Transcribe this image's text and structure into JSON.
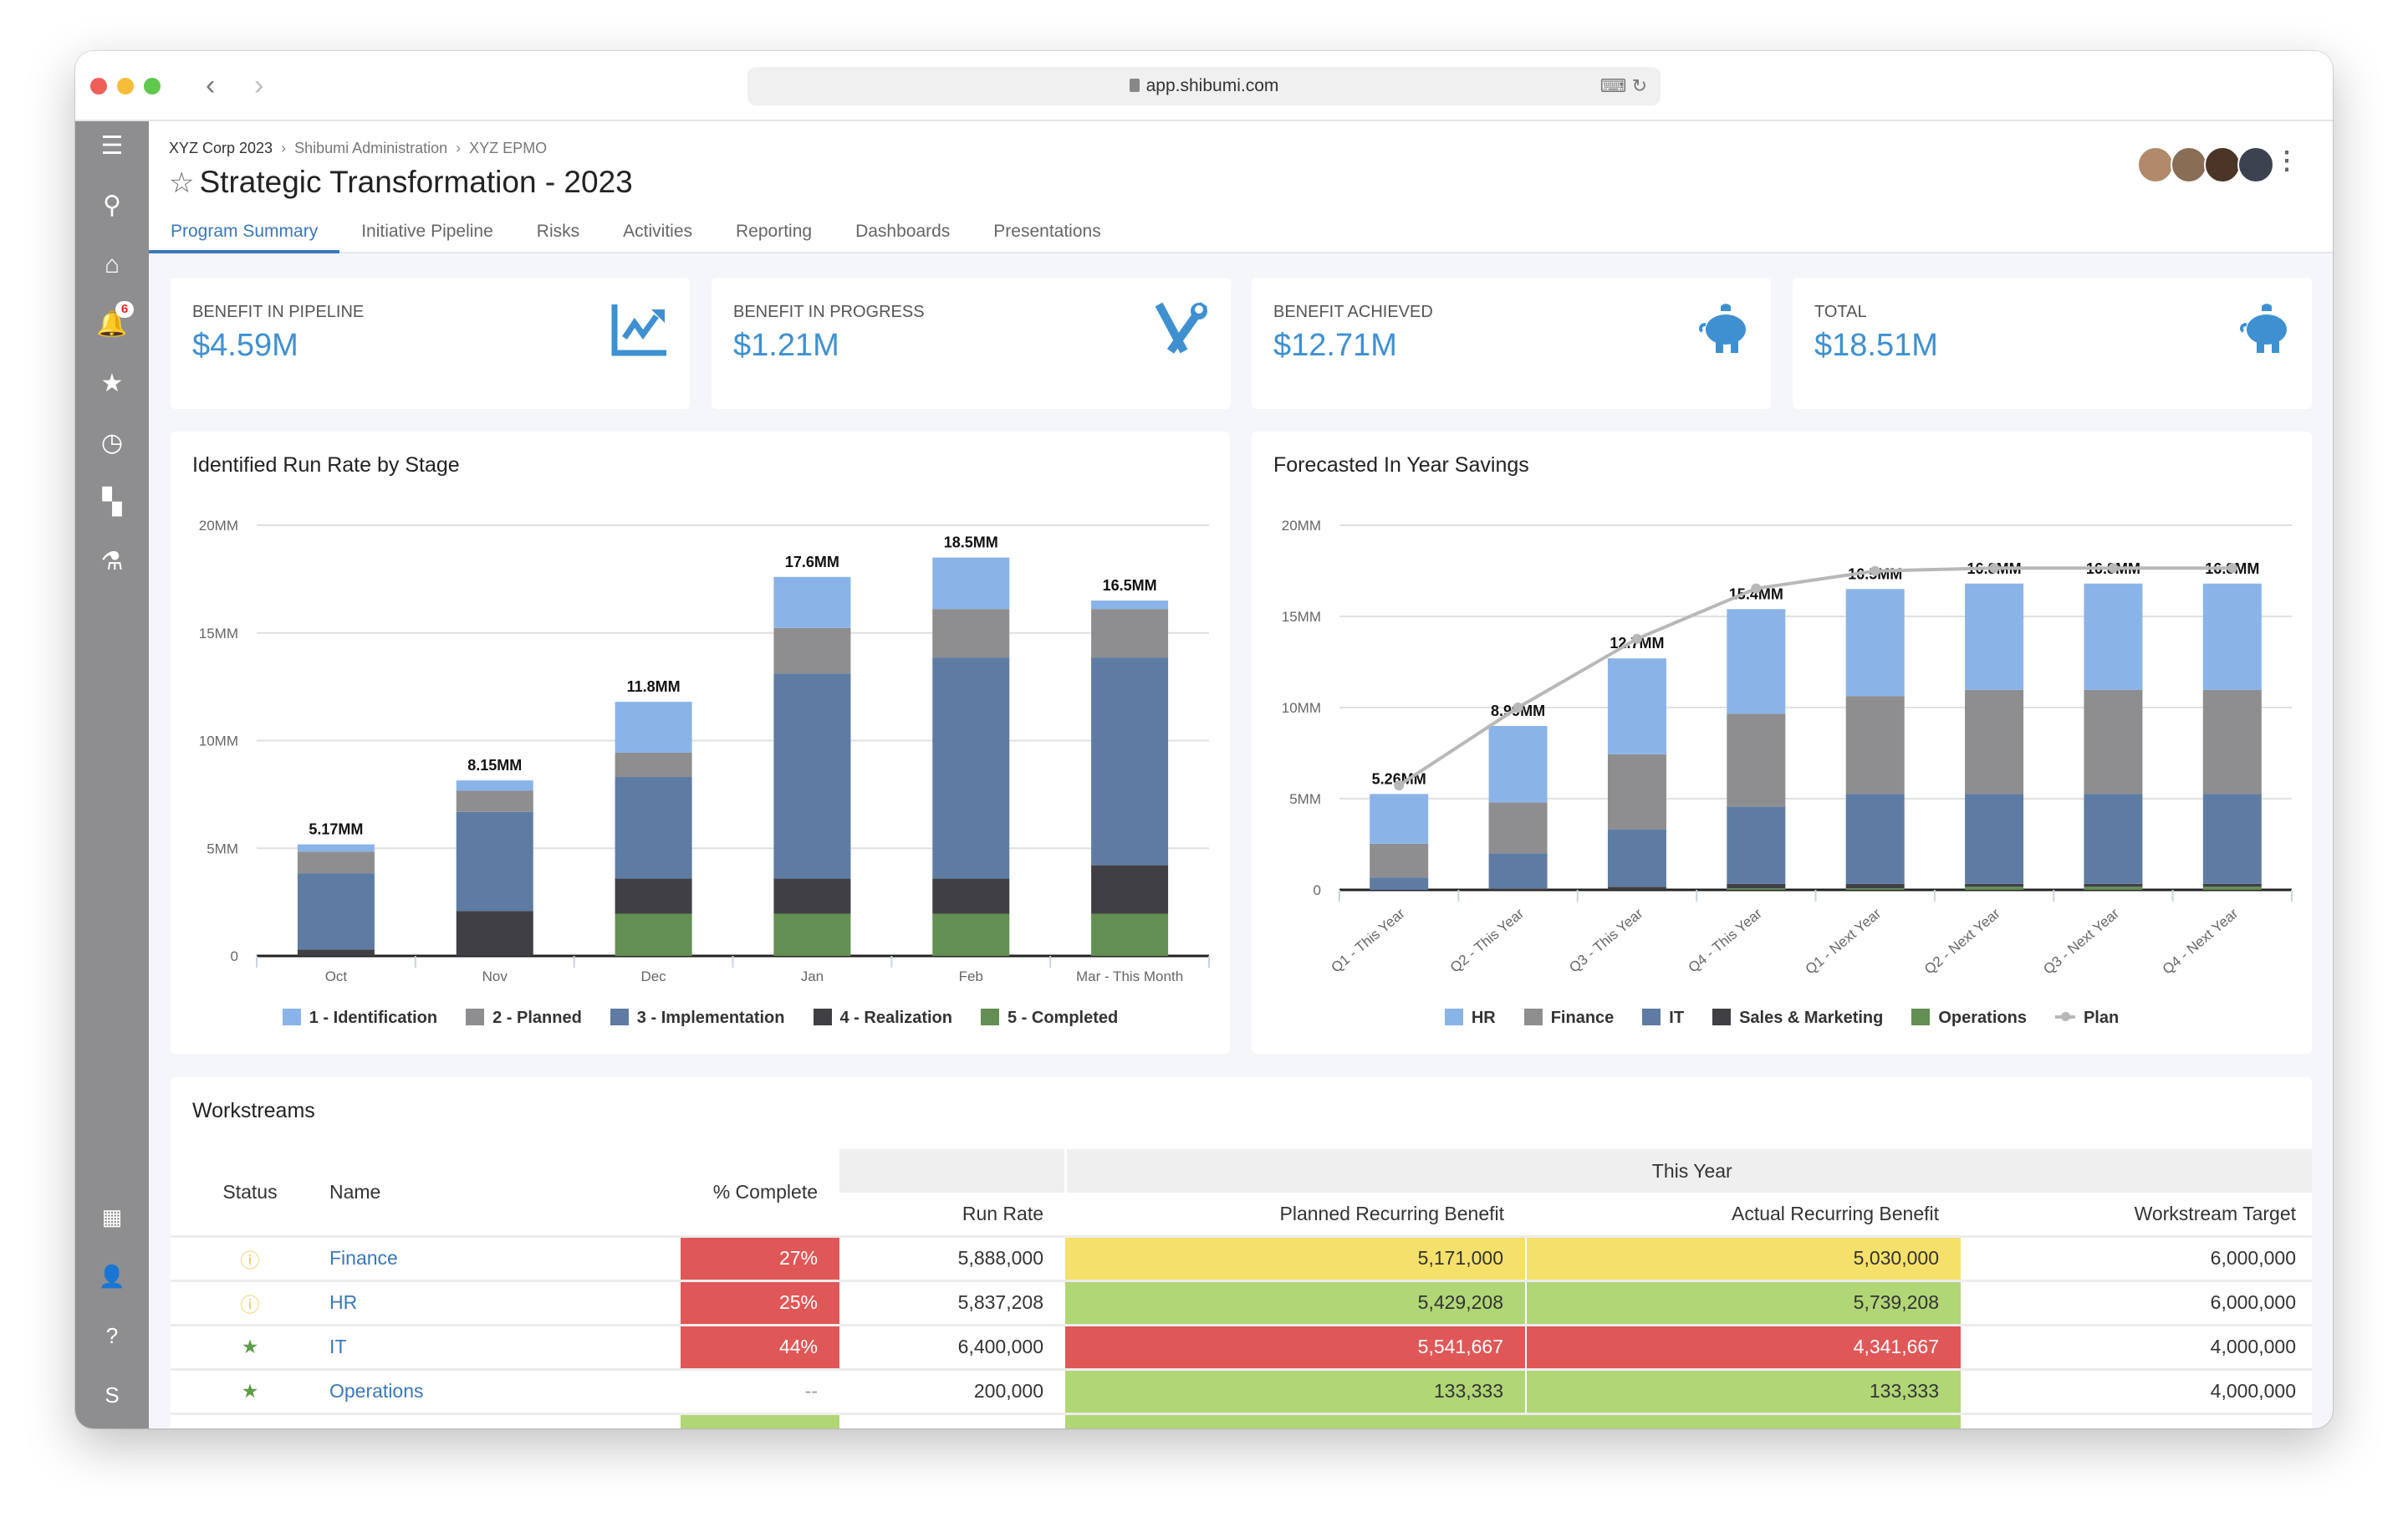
{
  "browser": {
    "url": "app.shibumi.com"
  },
  "sidebar": {
    "items": [
      {
        "icon": "menu-icon",
        "glyph": "☰"
      },
      {
        "icon": "search-icon",
        "glyph": "⚲"
      },
      {
        "icon": "home-icon",
        "glyph": "⌂"
      },
      {
        "icon": "bell-icon",
        "glyph": "🔔",
        "badge": "6"
      },
      {
        "icon": "star-icon",
        "glyph": "★"
      },
      {
        "icon": "clock-icon",
        "glyph": "◷"
      },
      {
        "icon": "hierarchy-icon",
        "glyph": "▚"
      },
      {
        "icon": "compass-icon",
        "glyph": "⚗"
      }
    ],
    "bottom_items": [
      {
        "icon": "building-icon",
        "glyph": "▦"
      },
      {
        "icon": "user-icon",
        "glyph": "👤"
      },
      {
        "icon": "help-icon",
        "glyph": "?"
      },
      {
        "icon": "shibumi-logo-icon",
        "glyph": "S"
      }
    ]
  },
  "header": {
    "breadcrumb": [
      "XYZ Corp 2023",
      "Shibumi Administration",
      "XYZ EPMO"
    ],
    "title": "Strategic Transformation - 2023",
    "tabs": [
      {
        "label": "Program Summary",
        "active": true
      },
      {
        "label": "Initiative Pipeline"
      },
      {
        "label": "Risks"
      },
      {
        "label": "Activities"
      },
      {
        "label": "Reporting"
      },
      {
        "label": "Dashboards"
      },
      {
        "label": "Presentations"
      }
    ]
  },
  "kpis": [
    {
      "label": "BENEFIT IN PIPELINE",
      "value": "$4.59M",
      "icon": "chart-line-icon"
    },
    {
      "label": "BENEFIT IN PROGRESS",
      "value": "$1.21M",
      "icon": "tools-icon"
    },
    {
      "label": "BENEFIT ACHIEVED",
      "value": "$12.71M",
      "icon": "piggy-bank-icon"
    },
    {
      "label": "TOTAL",
      "value": "$18.51M",
      "icon": "piggy-bank-icon"
    }
  ],
  "colors": {
    "accent": "#3a78b8",
    "kpi": "#3f90d0"
  },
  "chart_data": [
    {
      "type": "bar",
      "stacked": true,
      "title": "Identified Run Rate by Stage",
      "categories": [
        "Oct",
        "Nov",
        "Dec",
        "Jan",
        "Feb",
        "Mar - This Month"
      ],
      "yticks": [
        "0",
        "5MM",
        "10MM",
        "15MM",
        "20MM"
      ],
      "ylim": [
        0,
        20
      ],
      "grid": true,
      "legend": "bottom",
      "series": [
        {
          "name": "1 - Identification",
          "color": "#8ab4e8",
          "values": [
            0.34,
            0.48,
            2.36,
            2.37,
            2.39,
            0.39
          ]
        },
        {
          "name": "2 - Planned",
          "color": "#8e8e90",
          "values": [
            1.0,
            0.98,
            1.13,
            2.12,
            2.25,
            2.25
          ]
        },
        {
          "name": "3 - Implementation",
          "color": "#5e7ca3",
          "values": [
            3.54,
            4.6,
            4.72,
            9.52,
            10.27,
            9.65
          ]
        },
        {
          "name": "4 - Realization",
          "color": "#404044",
          "values": [
            0.3,
            2.09,
            1.63,
            1.63,
            1.63,
            2.25
          ]
        },
        {
          "name": "5 - Completed",
          "color": "#628f53",
          "values": [
            0,
            0,
            1.96,
            1.96,
            1.96,
            1.96
          ]
        }
      ],
      "totals": [
        "5.17MM",
        "8.15MM",
        "11.8MM",
        "17.6MM",
        "18.5MM",
        "16.5MM"
      ]
    },
    {
      "type": "bar",
      "stacked": true,
      "title": "Forecasted In Year Savings",
      "categories": [
        "Q1 - This Year",
        "Q2 - This Year",
        "Q3 - This Year",
        "Q4 - This Year",
        "Q1 - Next Year",
        "Q2 - Next Year",
        "Q3 - Next Year",
        "Q4 - Next Year"
      ],
      "yticks": [
        "0",
        "5MM",
        "10MM",
        "15MM",
        "20MM"
      ],
      "ylim": [
        0,
        20
      ],
      "grid": true,
      "legend": "bottom",
      "series": [
        {
          "name": "HR",
          "color": "#8ab4e8",
          "values": [
            2.73,
            4.19,
            5.26,
            5.74,
            5.87,
            5.83,
            5.83,
            5.83
          ]
        },
        {
          "name": "Finance",
          "color": "#8e8e90",
          "values": [
            1.85,
            2.8,
            4.12,
            5.09,
            5.38,
            5.72,
            5.72,
            5.72
          ]
        },
        {
          "name": "IT",
          "color": "#5e7ca3",
          "values": [
            0.68,
            1.92,
            3.15,
            4.24,
            4.92,
            4.92,
            4.92,
            4.92
          ]
        },
        {
          "name": "Sales & Marketing",
          "color": "#404044",
          "values": [
            0,
            0.08,
            0.17,
            0.25,
            0.25,
            0.16,
            0.16,
            0.16
          ]
        },
        {
          "name": "Operations",
          "color": "#628f53",
          "values": [
            0,
            0,
            0,
            0.08,
            0.08,
            0.17,
            0.17,
            0.17
          ]
        }
      ],
      "line": {
        "name": "Plan",
        "color": "#b8b8b8",
        "values": [
          5.73,
          10.0,
          13.77,
          16.53,
          17.49,
          17.65,
          17.65,
          17.65
        ]
      },
      "totals": [
        "5.26MM",
        "8.99MM",
        "12.7MM",
        "15.4MM",
        "16.5MM",
        "16.8MM",
        "16.8MM",
        "16.8MM"
      ]
    }
  ],
  "workstreams": {
    "title": "Workstreams",
    "group_header": "This Year",
    "columns": [
      "Status",
      "Name",
      "% Complete",
      "Run Rate",
      "Planned Recurring Benefit",
      "Actual Recurring Benefit",
      "Workstream Target"
    ],
    "rows": [
      {
        "status": "info-icon",
        "name": "Finance",
        "pct": "27%",
        "run_rate": "5,888,000",
        "planned": "5,171,000",
        "actual": "5,030,000",
        "target": "6,000,000",
        "pct_c": "red",
        "pl_c": "yel",
        "ac_c": "yel"
      },
      {
        "status": "info-icon",
        "name": "HR",
        "pct": "25%",
        "run_rate": "5,837,208",
        "planned": "5,429,208",
        "actual": "5,739,208",
        "target": "6,000,000",
        "pct_c": "red",
        "pl_c": "grn",
        "ac_c": "grn"
      },
      {
        "status": "star-icon",
        "name": "IT",
        "pct": "44%",
        "run_rate": "6,400,000",
        "planned": "5,541,667",
        "actual": "4,341,667",
        "target": "4,000,000",
        "pct_c": "red",
        "pl_c": "red",
        "ac_c": "red"
      },
      {
        "status": "star-icon",
        "name": "Operations",
        "pct": "--",
        "run_rate": "200,000",
        "planned": "133,333",
        "actual": "133,333",
        "target": "4,000,000",
        "pct_c": "",
        "pl_c": "grn",
        "ac_c": "grn"
      }
    ]
  }
}
